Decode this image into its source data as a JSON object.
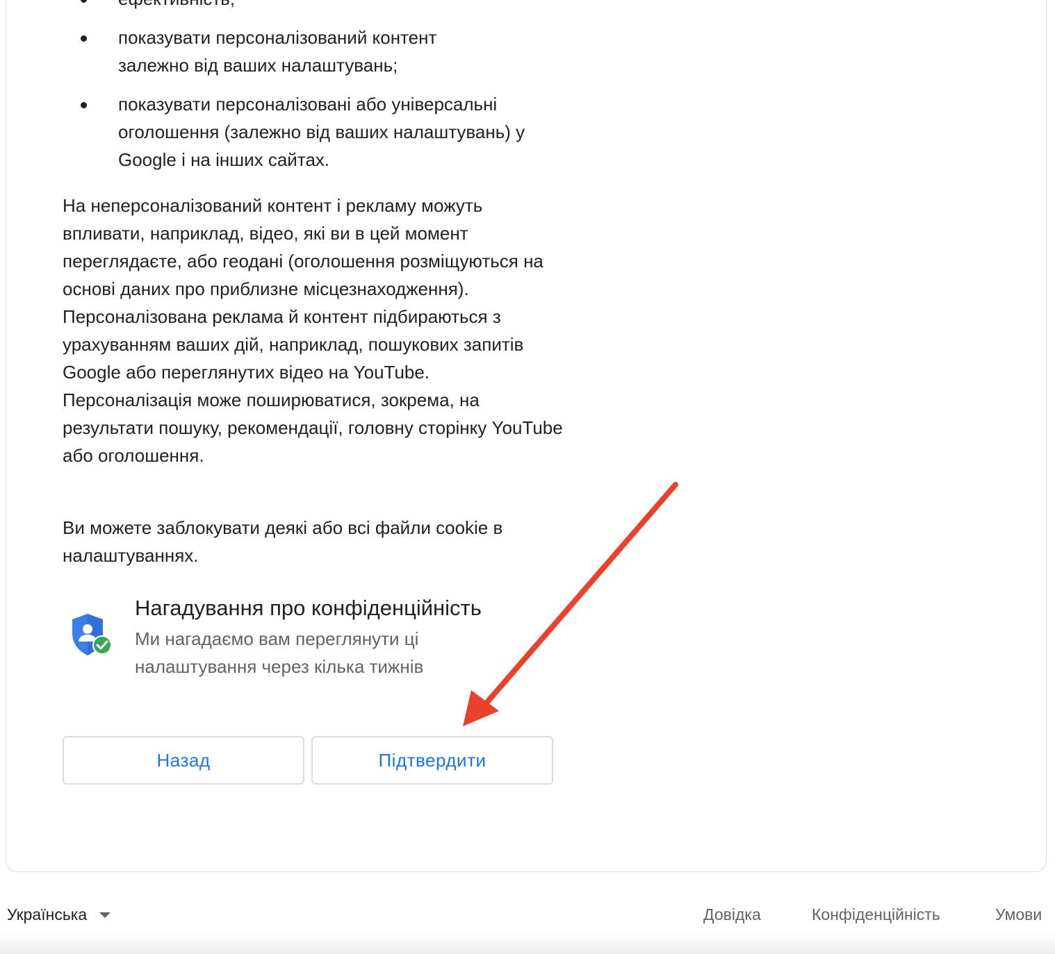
{
  "colors": {
    "accent": "#1a73e8",
    "text": "#202124",
    "secondary_text": "#5f6368",
    "border": "#dadce0",
    "arrow": "#e8412c",
    "shield_blue": "#3c7ee9",
    "check_green": "#34a853"
  },
  "bullets": [
    "ефективність;",
    "показувати персоналізований контент залежно від ваших налаштувань;",
    "показувати персоналізовані або універсальні оголошення (залежно від ваших налаштувань) у Google і на інших сайтах."
  ],
  "paragraphs": {
    "personalization": "На неперсоналізований контент і рекламу можуть впливати, наприклад, відео, які ви в цей момент переглядаєте, або геодані (оголошення розміщуються на основі даних про приблизне місцезнаходження). Персоналізована реклама й контент підбираються з урахуванням ваших дій, наприклад, пошукових запитів Google або переглянутих відео на YouTube. Персоналізація може поширюватися, зокрема, на результати пошуку, рекомендації, головну сторінку YouTube або оголошення.",
    "cookies": "Ви можете заблокувати деякі або всі файли cookie в налаштуваннях."
  },
  "reminder": {
    "icon": "shield-check-icon",
    "title": "Нагадування про конфіденційність",
    "description": "Ми нагадаємо вам переглянути ці налаштування через кілька тижнів"
  },
  "buttons": {
    "back": "Назад",
    "confirm": "Підтвердити"
  },
  "footer": {
    "language": "Українська",
    "help": "Довідка",
    "privacy": "Конфіденційність",
    "terms": "Умови"
  }
}
